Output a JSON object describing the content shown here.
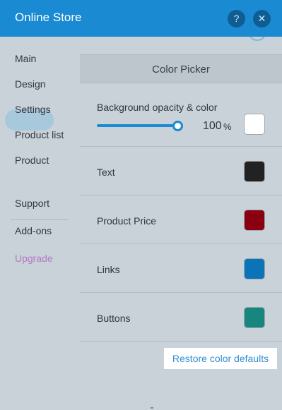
{
  "header": {
    "title": "Online Store",
    "help_label": "?",
    "close_label": "✕"
  },
  "sidebar": {
    "items": [
      {
        "label": "Main"
      },
      {
        "label": "Design",
        "active": true
      },
      {
        "label": "Settings"
      },
      {
        "label": "Product list"
      },
      {
        "label": "Product"
      }
    ],
    "secondary_items": [
      {
        "label": "Support"
      },
      {
        "label": "Add-ons"
      },
      {
        "label": "Upgrade",
        "color": "#b57ac4"
      }
    ]
  },
  "color_picker": {
    "title": "Color Picker",
    "background": {
      "label": "Background opacity & color",
      "opacity_value": "100",
      "opacity_unit": "%",
      "opacity_fraction": 1.0,
      "color": "#ffffff"
    },
    "rows": [
      {
        "label": "Text",
        "color": "#222222"
      },
      {
        "label": "Product Price",
        "color": "#8b0011"
      },
      {
        "label": "Links",
        "color": "#0b73b8"
      },
      {
        "label": "Buttons",
        "color": "#16867f"
      }
    ],
    "restore_label": "Restore color defaults"
  },
  "colors": {
    "header": "#1a8ad2",
    "panel": "#c9d2d8",
    "accent": "#1a8ad2"
  }
}
